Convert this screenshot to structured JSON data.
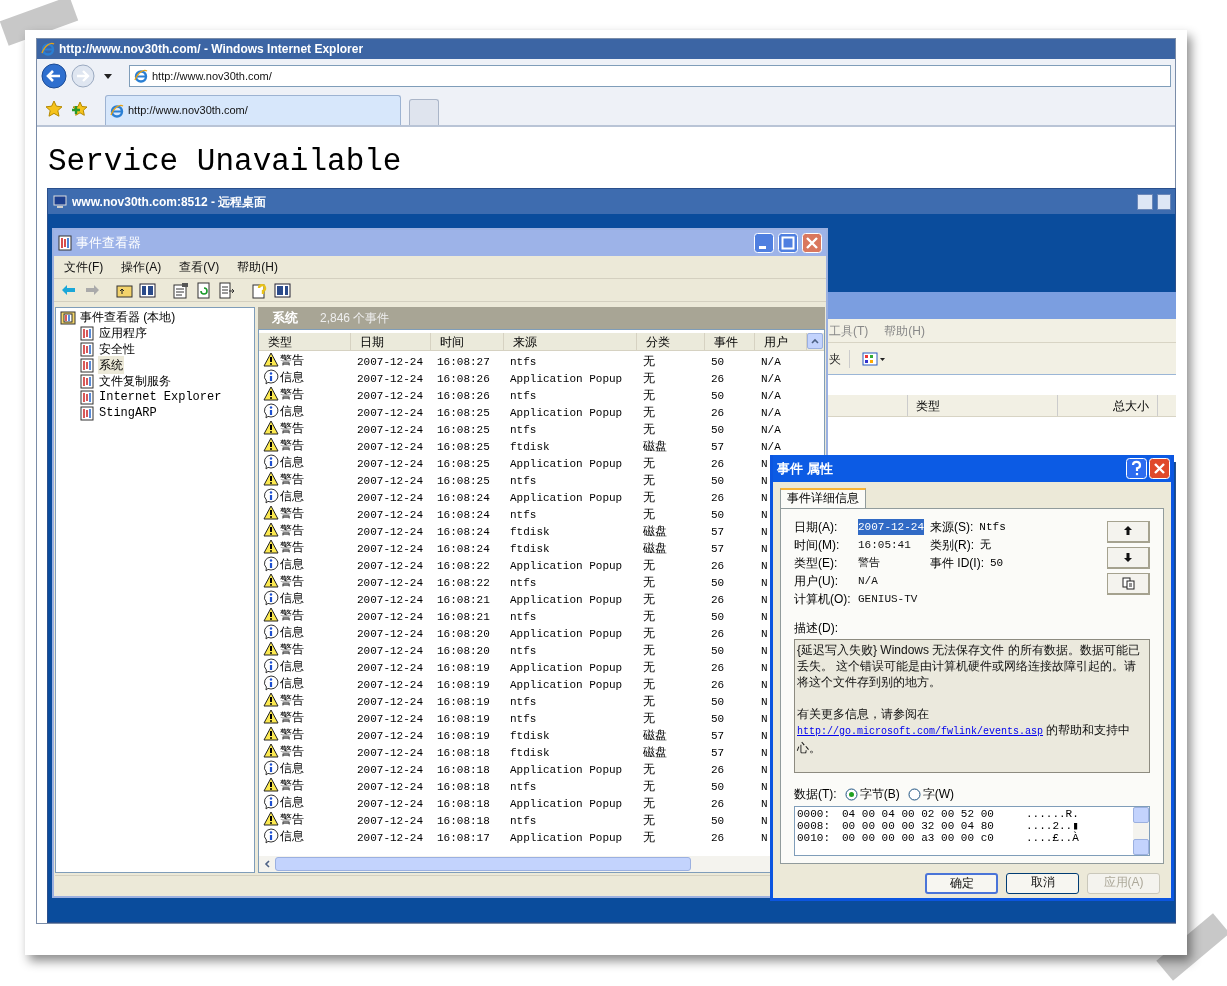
{
  "browser": {
    "title": "http://www.nov30th.com/ - Windows Internet Explorer",
    "address": "http://www.nov30th.com/",
    "tabs": [
      {
        "label": "http://www.nov30th.com/",
        "selected": true
      }
    ],
    "page_heading": "Service Unavailable"
  },
  "remote_desktop": {
    "title": "www.nov30th.com:8512 - 远程桌面"
  },
  "event_viewer": {
    "title": "事件查看器",
    "menu": [
      "文件(F)",
      "操作(A)",
      "查看(V)",
      "帮助(H)"
    ],
    "tree": {
      "label": "事件查看器 (本地)",
      "children": [
        {
          "label": "应用程序",
          "selected": false
        },
        {
          "label": "安全性",
          "selected": false
        },
        {
          "label": "系统",
          "selected": true
        },
        {
          "label": "文件复制服务",
          "selected": false
        },
        {
          "label": "Internet Explorer",
          "selected": false
        },
        {
          "label": "StingARP",
          "selected": false
        }
      ]
    },
    "log_name": "系统",
    "event_count": "2,846 个事件",
    "columns": [
      "类型",
      "日期",
      "时间",
      "来源",
      "分类",
      "事件",
      "用户"
    ],
    "rows": [
      {
        "kind": "warning",
        "type": "警告",
        "date": "2007-12-24",
        "time": "16:08:27",
        "source": "ntfs",
        "category": "无",
        "event": "50",
        "user": "N/A"
      },
      {
        "kind": "info",
        "type": "信息",
        "date": "2007-12-24",
        "time": "16:08:26",
        "source": "Application Popup",
        "category": "无",
        "event": "26",
        "user": "N/A"
      },
      {
        "kind": "warning",
        "type": "警告",
        "date": "2007-12-24",
        "time": "16:08:26",
        "source": "ntfs",
        "category": "无",
        "event": "50",
        "user": "N/A"
      },
      {
        "kind": "info",
        "type": "信息",
        "date": "2007-12-24",
        "time": "16:08:25",
        "source": "Application Popup",
        "category": "无",
        "event": "26",
        "user": "N/A"
      },
      {
        "kind": "warning",
        "type": "警告",
        "date": "2007-12-24",
        "time": "16:08:25",
        "source": "ntfs",
        "category": "无",
        "event": "50",
        "user": "N/A"
      },
      {
        "kind": "warning",
        "type": "警告",
        "date": "2007-12-24",
        "time": "16:08:25",
        "source": "ftdisk",
        "category": "磁盘",
        "event": "57",
        "user": "N/A"
      },
      {
        "kind": "info",
        "type": "信息",
        "date": "2007-12-24",
        "time": "16:08:25",
        "source": "Application Popup",
        "category": "无",
        "event": "26",
        "user": "N"
      },
      {
        "kind": "warning",
        "type": "警告",
        "date": "2007-12-24",
        "time": "16:08:25",
        "source": "ntfs",
        "category": "无",
        "event": "50",
        "user": "N"
      },
      {
        "kind": "info",
        "type": "信息",
        "date": "2007-12-24",
        "time": "16:08:24",
        "source": "Application Popup",
        "category": "无",
        "event": "26",
        "user": "N"
      },
      {
        "kind": "warning",
        "type": "警告",
        "date": "2007-12-24",
        "time": "16:08:24",
        "source": "ntfs",
        "category": "无",
        "event": "50",
        "user": "N"
      },
      {
        "kind": "warning",
        "type": "警告",
        "date": "2007-12-24",
        "time": "16:08:24",
        "source": "ftdisk",
        "category": "磁盘",
        "event": "57",
        "user": "N"
      },
      {
        "kind": "warning",
        "type": "警告",
        "date": "2007-12-24",
        "time": "16:08:24",
        "source": "ftdisk",
        "category": "磁盘",
        "event": "57",
        "user": "N"
      },
      {
        "kind": "info",
        "type": "信息",
        "date": "2007-12-24",
        "time": "16:08:22",
        "source": "Application Popup",
        "category": "无",
        "event": "26",
        "user": "N"
      },
      {
        "kind": "warning",
        "type": "警告",
        "date": "2007-12-24",
        "time": "16:08:22",
        "source": "ntfs",
        "category": "无",
        "event": "50",
        "user": "N"
      },
      {
        "kind": "info",
        "type": "信息",
        "date": "2007-12-24",
        "time": "16:08:21",
        "source": "Application Popup",
        "category": "无",
        "event": "26",
        "user": "N"
      },
      {
        "kind": "warning",
        "type": "警告",
        "date": "2007-12-24",
        "time": "16:08:21",
        "source": "ntfs",
        "category": "无",
        "event": "50",
        "user": "N"
      },
      {
        "kind": "info",
        "type": "信息",
        "date": "2007-12-24",
        "time": "16:08:20",
        "source": "Application Popup",
        "category": "无",
        "event": "26",
        "user": "N"
      },
      {
        "kind": "warning",
        "type": "警告",
        "date": "2007-12-24",
        "time": "16:08:20",
        "source": "ntfs",
        "category": "无",
        "event": "50",
        "user": "N"
      },
      {
        "kind": "info",
        "type": "信息",
        "date": "2007-12-24",
        "time": "16:08:19",
        "source": "Application Popup",
        "category": "无",
        "event": "26",
        "user": "N"
      },
      {
        "kind": "info",
        "type": "信息",
        "date": "2007-12-24",
        "time": "16:08:19",
        "source": "Application Popup",
        "category": "无",
        "event": "26",
        "user": "N"
      },
      {
        "kind": "warning",
        "type": "警告",
        "date": "2007-12-24",
        "time": "16:08:19",
        "source": "ntfs",
        "category": "无",
        "event": "50",
        "user": "N"
      },
      {
        "kind": "warning",
        "type": "警告",
        "date": "2007-12-24",
        "time": "16:08:19",
        "source": "ntfs",
        "category": "无",
        "event": "50",
        "user": "N"
      },
      {
        "kind": "warning",
        "type": "警告",
        "date": "2007-12-24",
        "time": "16:08:19",
        "source": "ftdisk",
        "category": "磁盘",
        "event": "57",
        "user": "N"
      },
      {
        "kind": "warning",
        "type": "警告",
        "date": "2007-12-24",
        "time": "16:08:18",
        "source": "ftdisk",
        "category": "磁盘",
        "event": "57",
        "user": "N"
      },
      {
        "kind": "info",
        "type": "信息",
        "date": "2007-12-24",
        "time": "16:08:18",
        "source": "Application Popup",
        "category": "无",
        "event": "26",
        "user": "N"
      },
      {
        "kind": "warning",
        "type": "警告",
        "date": "2007-12-24",
        "time": "16:08:18",
        "source": "ntfs",
        "category": "无",
        "event": "50",
        "user": "N"
      },
      {
        "kind": "info",
        "type": "信息",
        "date": "2007-12-24",
        "time": "16:08:18",
        "source": "Application Popup",
        "category": "无",
        "event": "26",
        "user": "N"
      },
      {
        "kind": "warning",
        "type": "警告",
        "date": "2007-12-24",
        "time": "16:08:18",
        "source": "ntfs",
        "category": "无",
        "event": "50",
        "user": "N"
      },
      {
        "kind": "info",
        "type": "信息",
        "date": "2007-12-24",
        "time": "16:08:17",
        "source": "Application Popup",
        "category": "无",
        "event": "26",
        "user": "N"
      }
    ]
  },
  "background_window": {
    "menu": [
      "工具(T)",
      "帮助(H)"
    ],
    "toolbar_label": "夹",
    "columns": [
      "类型",
      "总大小"
    ]
  },
  "dialog": {
    "title": "事件 属性",
    "tabs": [
      {
        "label": "事件详细信息",
        "selected": true
      }
    ],
    "left_fields": [
      {
        "label": "日期(A):",
        "value": "2007-12-24",
        "selected": true
      },
      {
        "label": "时间(M):",
        "value": "16:05:41",
        "selected": false
      },
      {
        "label": "类型(E):",
        "value": "警告",
        "selected": false
      },
      {
        "label": "用户(U):",
        "value": "N/A",
        "selected": false
      },
      {
        "label": "计算机(O):",
        "value": "GENIUS-TV",
        "selected": false
      }
    ],
    "right_fields": [
      {
        "label": "来源(S):",
        "value": "Ntfs"
      },
      {
        "label": "类别(R):",
        "value": "无"
      },
      {
        "label": "事件 ID(I):",
        "value": "50"
      }
    ],
    "description_label": "描述(D):",
    "description": {
      "text": "{延迟写入失败} Windows 无法保存文件  的所有数据。数据可能已丢失。 这个错误可能是由计算机硬件或网络连接故障引起的。请将这个文件存到别的地方。",
      "more": "有关更多信息，请参阅在",
      "link": "http://go.microsoft.com/fwlink/events.asp",
      "after": " 的帮助和支持中心。"
    },
    "data_label": "数据(T):",
    "data_format": [
      {
        "label": "字节(B)",
        "selected": true
      },
      {
        "label": "字(W)",
        "selected": false
      }
    ],
    "data_lines": [
      {
        "offset": "0000:",
        "bytes": "04 00 04 00 02 00 52 00",
        "chars": "......R."
      },
      {
        "offset": "0008:",
        "bytes": "00 00 00 00 32 00 04 80",
        "chars": "....2..▮"
      },
      {
        "offset": "0010:",
        "bytes": "00 00 00 00 a3 00 00 c0",
        "chars": "....£..À"
      }
    ],
    "buttons": [
      {
        "label": "确定",
        "default": true,
        "disabled": false
      },
      {
        "label": "取消",
        "default": false,
        "disabled": false
      },
      {
        "label": "应用(A)",
        "default": false,
        "disabled": true
      }
    ]
  }
}
